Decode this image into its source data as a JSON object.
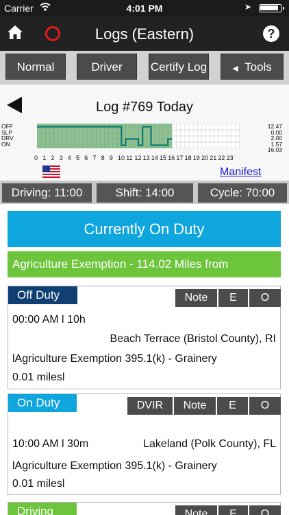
{
  "status_bar": {
    "carrier": "Carrier",
    "time": "4:01 PM"
  },
  "nav": {
    "title": "Logs (Eastern)",
    "help": "?"
  },
  "toolbar": {
    "normal": "Normal",
    "driver": "Driver",
    "certify": "Certify Log",
    "tools": "Tools"
  },
  "log": {
    "title": "Log #769 Today",
    "rows": [
      "OFF",
      "SLP",
      "DRV",
      "ON"
    ],
    "totals": [
      "12.47",
      "0.00",
      "2.00",
      "1.57",
      "16.03"
    ],
    "hours": [
      "0",
      "1",
      "2",
      "3",
      "4",
      "5",
      "6",
      "7",
      "8",
      "9",
      "10",
      "11",
      "12",
      "13",
      "14",
      "15",
      "16",
      "17",
      "18",
      "19",
      "20",
      "21",
      "22",
      "23"
    ],
    "manifest": "Manifest"
  },
  "counters": {
    "driving": "Driving: 11:00",
    "shift": "Shift: 14:00",
    "cycle": "Cycle: 70:00"
  },
  "duty_status": "Currently On Duty",
  "exemption": "Agriculture Exemption - 114.02 Miles from",
  "entries": [
    {
      "status": "Off Duty",
      "time": "00:00 AM l 10h",
      "location": "Beach Terrace (Bristol County), RI",
      "note": "lAgriculture Exemption 395.1(k) - Grainery",
      "miles": "0.01 milesl",
      "buttons": [
        "Note",
        "E",
        "O"
      ]
    },
    {
      "status": "On Duty",
      "time": "10:00 AM l 30m",
      "location": "Lakeland (Polk County), FL",
      "note": "lAgriculture Exemption 395.1(k) - Grainery",
      "miles": "0.01 milesl",
      "buttons": [
        "DVIR",
        "Note",
        "E",
        "O"
      ]
    },
    {
      "status": "Driving",
      "buttons": [
        "Note",
        "E",
        "O"
      ]
    }
  ],
  "colors": {
    "nav": "#222222",
    "duty_blue": "#0fa5dd",
    "exemption_green": "#6cc53b",
    "off_duty_navy": "#0f3f73",
    "graph_fill": "#8cbf8f",
    "graph_line": "#0b7a73"
  },
  "icons": {
    "home": "home-icon",
    "record": "record-icon",
    "help": "help-icon",
    "back": "back-arrow-icon",
    "flag": "us-flag-icon"
  }
}
